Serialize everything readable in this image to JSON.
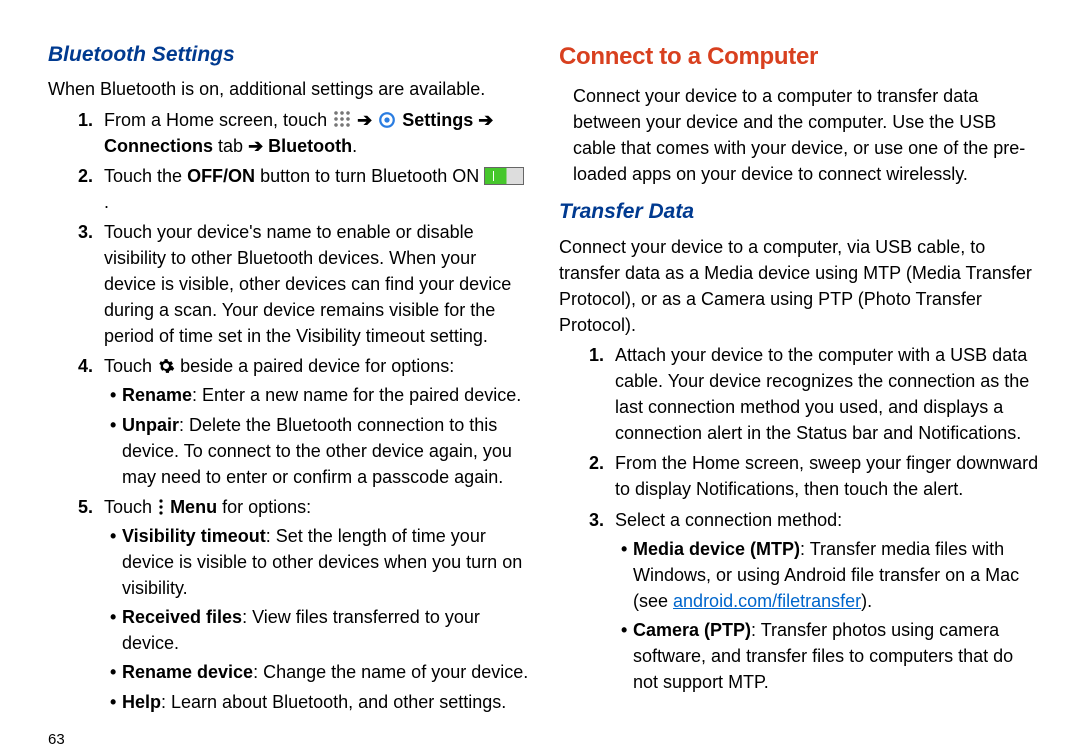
{
  "left": {
    "heading": "Bluetooth Settings",
    "intro": "When Bluetooth is on, additional settings are available.",
    "step1_a": "From a Home screen, touch ",
    "arrow": " ➔ ",
    "settings_label": "Settings",
    "connections_tab": "Connections",
    "tab_word": " tab ",
    "bluetooth_label": "Bluetooth",
    "step2_a": "Touch the ",
    "offon": "OFF/ON",
    "step2_b": " button to turn Bluetooth ON ",
    "step3": "Touch your device's name to enable or disable visibility to other Bluetooth devices. When your device is visible, other devices can find your device during a scan. Your device remains visible for the period of time set in the Visibility timeout setting.",
    "step4_a": "Touch ",
    "step4_b": " beside a paired device for options:",
    "s4_rename_label": "Rename",
    "s4_rename_text": ": Enter a new name for the paired device.",
    "s4_unpair_label": "Unpair",
    "s4_unpair_text": ": Delete the Bluetooth connection to this device. To connect to the other device again, you may need to enter or confirm a passcode again.",
    "step5_a": "Touch ",
    "menu_label": "Menu",
    "step5_b": " for options:",
    "s5_vis_label": "Visibility timeout",
    "s5_vis_text": ": Set the length of time your device is visible to other devices when you turn on visibility.",
    "s5_recv_label": "Received files",
    "s5_recv_text": ": View files transferred to your device.",
    "s5_rendev_label": "Rename device",
    "s5_rendev_text": ": Change the name of your device.",
    "s5_help_label": "Help",
    "s5_help_text": ": Learn about Bluetooth, and other settings.",
    "page": "63"
  },
  "right": {
    "heading": "Connect to a Computer",
    "intro": "Connect your device to a computer to transfer data between your device and the computer. Use the USB cable that comes with your device, or use one of the pre-loaded apps on your device to connect wirelessly.",
    "sub_heading": "Transfer Data",
    "sub_intro": "Connect your device to a computer, via USB cable, to transfer data as a Media device using MTP (Media Transfer Protocol), or as a Camera using PTP (Photo Transfer Protocol).",
    "step1": "Attach your device to the computer with a USB data cable. Your device recognizes the connection as the last connection method you used, and displays a connection alert in the Status bar and Notifications.",
    "step2": "From the Home screen, sweep your finger downward to display Notifications, then touch the alert.",
    "step3": "Select a connection method:",
    "mtp_label": "Media device (MTP)",
    "mtp_text_a": ": Transfer media files with Windows, or using Android file transfer on a Mac (see ",
    "mtp_link": "android.com/filetransfer",
    "mtp_text_b": ").",
    "ptp_label": "Camera (PTP)",
    "ptp_text": ": Transfer photos using camera software, and transfer files to computers that do not support MTP."
  }
}
